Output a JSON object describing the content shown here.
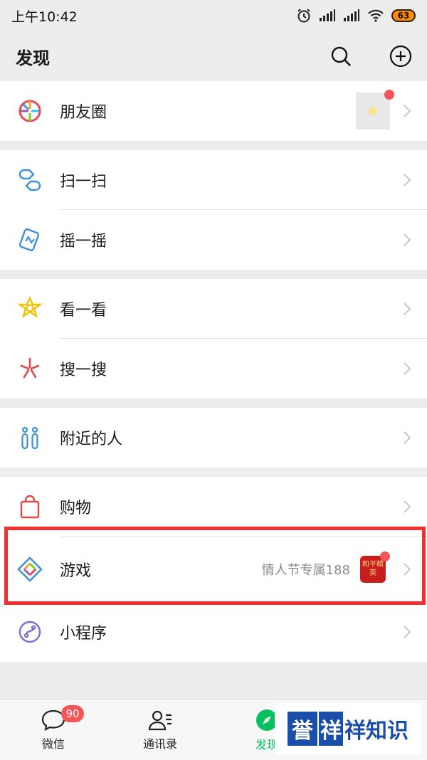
{
  "status": {
    "time": "上午10:42",
    "battery": "63"
  },
  "header": {
    "title": "发现"
  },
  "rows": {
    "moments": {
      "label": "朋友圈"
    },
    "scan": {
      "label": "扫一扫"
    },
    "shake": {
      "label": "摇一摇"
    },
    "top_stories": {
      "label": "看一看"
    },
    "search": {
      "label": "搜一搜"
    },
    "nearby": {
      "label": "附近的人"
    },
    "shopping": {
      "label": "购物"
    },
    "games": {
      "label": "游戏",
      "subtitle": "情人节专属188",
      "thumb_text": "和平精英"
    },
    "mini_programs": {
      "label": "小程序"
    }
  },
  "tabs": [
    {
      "label": "微信",
      "badge": "90"
    },
    {
      "label": "通讯录"
    },
    {
      "label": "发现"
    }
  ],
  "watermark": {
    "part1": "誉",
    "part2": "祥",
    "part3": "祥知识"
  },
  "colors": {
    "accent": "#07c160",
    "badge": "#f25656",
    "highlight": "#f32f2f"
  }
}
